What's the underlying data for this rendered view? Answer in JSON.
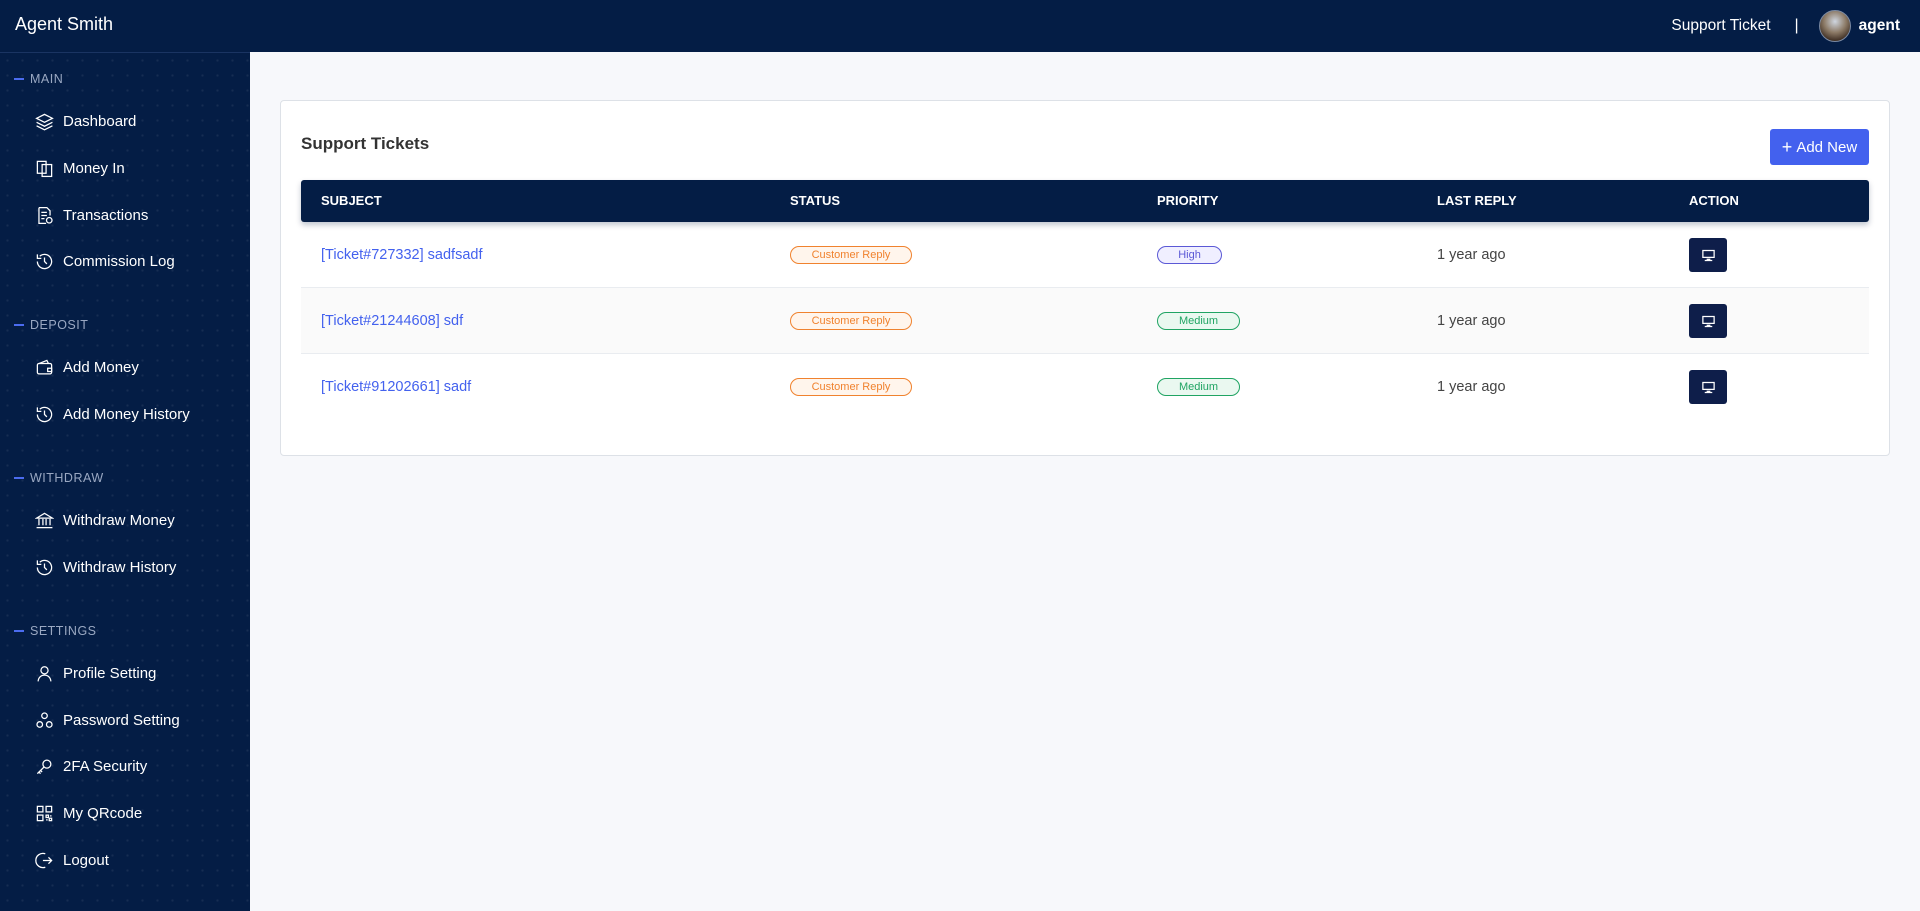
{
  "header": {
    "brand": "Agent Smith",
    "support_link": "Support Ticket",
    "separator": "|",
    "user_name": "agent"
  },
  "sidebar": {
    "sections": [
      {
        "title": "MAIN",
        "items": [
          {
            "label": "Dashboard",
            "icon": "layers-icon"
          },
          {
            "label": "Money In",
            "icon": "copy-icon"
          },
          {
            "label": "Transactions",
            "icon": "receipt-icon"
          },
          {
            "label": "Commission Log",
            "icon": "history-icon"
          }
        ]
      },
      {
        "title": "DEPOSIT",
        "items": [
          {
            "label": "Add Money",
            "icon": "wallet-icon"
          },
          {
            "label": "Add Money History",
            "icon": "history-icon"
          }
        ]
      },
      {
        "title": "WITHDRAW",
        "items": [
          {
            "label": "Withdraw Money",
            "icon": "bank-icon"
          },
          {
            "label": "Withdraw History",
            "icon": "history-icon"
          }
        ]
      },
      {
        "title": "SETTINGS",
        "items": [
          {
            "label": "Profile Setting",
            "icon": "user-icon"
          },
          {
            "label": "Password Setting",
            "icon": "password-icon"
          },
          {
            "label": "2FA Security",
            "icon": "key-icon"
          },
          {
            "label": "My QRcode",
            "icon": "qrcode-icon"
          },
          {
            "label": "Logout",
            "icon": "logout-icon"
          }
        ]
      }
    ]
  },
  "main": {
    "card_title": "Support Tickets",
    "add_button": "Add New",
    "columns": [
      "SUBJECT",
      "STATUS",
      "PRIORITY",
      "LAST REPLY",
      "ACTION"
    ],
    "tickets": [
      {
        "subject": "[Ticket#727332] sadfsadf",
        "status": "Customer Reply",
        "priority": "High",
        "last_reply": "1 year ago"
      },
      {
        "subject": "[Ticket#21244608] sdf",
        "status": "Customer Reply",
        "priority": "Medium",
        "last_reply": "1 year ago"
      },
      {
        "subject": "[Ticket#91202661] sadf",
        "status": "Customer Reply",
        "priority": "Medium",
        "last_reply": "1 year ago"
      }
    ]
  },
  "colors": {
    "navy": "#041d45",
    "accent": "#4361ee",
    "status_orange": "#f0822e",
    "priority_high": "#5b59d6",
    "priority_medium": "#20a463"
  }
}
